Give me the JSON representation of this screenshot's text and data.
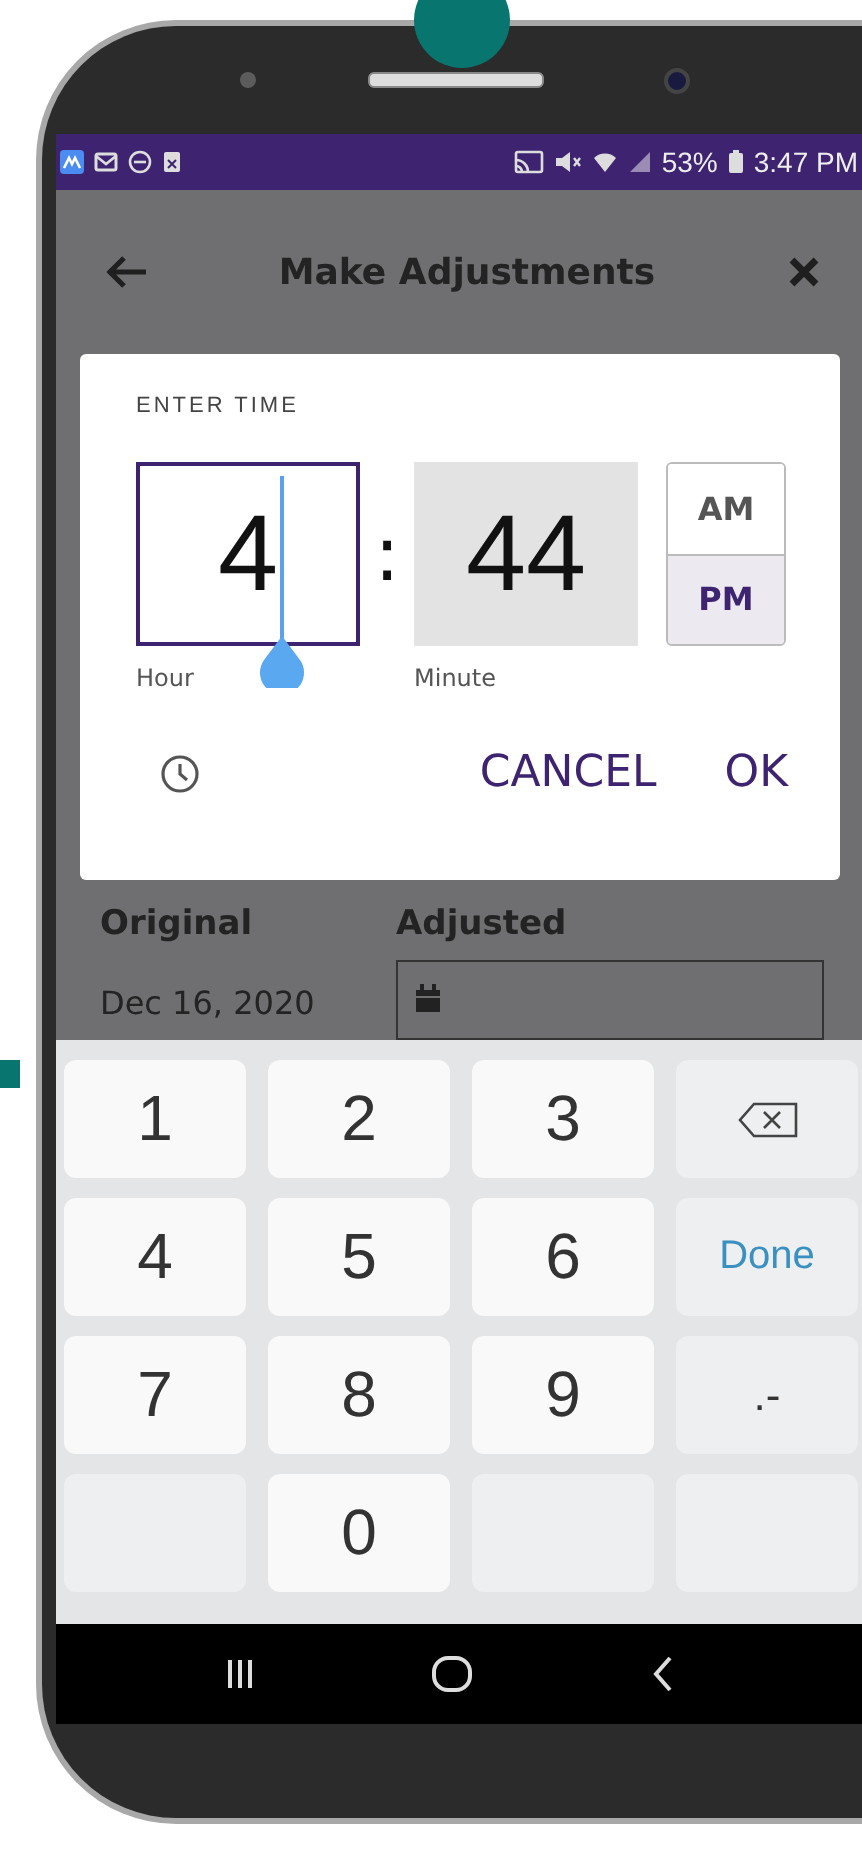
{
  "status_bar": {
    "battery": "53%",
    "time": "3:47 PM"
  },
  "app_bar": {
    "title": "Make Adjustments"
  },
  "time_dialog": {
    "heading": "ENTER TIME",
    "hour": {
      "value": "4",
      "label": "Hour",
      "selected": true
    },
    "separator": ":",
    "minute": {
      "value": "44",
      "label": "Minute",
      "selected": false
    },
    "periods": [
      {
        "label": "AM",
        "selected": false
      },
      {
        "label": "PM",
        "selected": true
      }
    ],
    "buttons": [
      "CANCEL",
      "OK"
    ]
  },
  "form": {
    "columns": [
      "Original",
      "Adjusted"
    ],
    "original_date": "Dec 16, 2020"
  },
  "keypad": {
    "keys": [
      {
        "kind": "digit",
        "label": "1"
      },
      {
        "kind": "digit",
        "label": "2"
      },
      {
        "kind": "digit",
        "label": "3"
      },
      {
        "kind": "backspace"
      },
      {
        "kind": "digit",
        "label": "4"
      },
      {
        "kind": "digit",
        "label": "5"
      },
      {
        "kind": "digit",
        "label": "6"
      },
      {
        "kind": "action",
        "label": "Done"
      },
      {
        "kind": "digit",
        "label": "7"
      },
      {
        "kind": "digit",
        "label": "8"
      },
      {
        "kind": "digit",
        "label": "9"
      },
      {
        "kind": "symbol",
        "label": ".-"
      },
      {
        "kind": "blank"
      },
      {
        "kind": "digit",
        "label": "0"
      },
      {
        "kind": "blank"
      },
      {
        "kind": "blank"
      }
    ]
  }
}
